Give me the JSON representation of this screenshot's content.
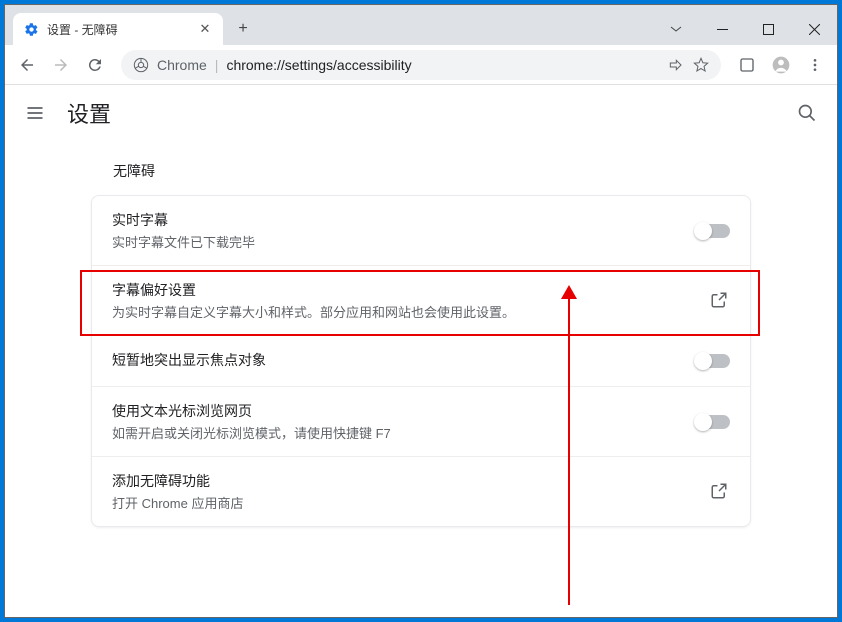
{
  "tab": {
    "title": "设置 - 无障碍"
  },
  "address": {
    "origin": "Chrome",
    "path": "chrome://settings/accessibility"
  },
  "header": {
    "title": "设置"
  },
  "section": {
    "title": "无障碍"
  },
  "rows": {
    "live_caption": {
      "title": "实时字幕",
      "sub": "实时字幕文件已下载完毕"
    },
    "caption_pref": {
      "title": "字幕偏好设置",
      "sub": "为实时字幕自定义字幕大小和样式。部分应用和网站也会使用此设置。"
    },
    "focus_highlight": {
      "title": "短暂地突出显示焦点对象"
    },
    "caret_browse": {
      "title": "使用文本光标浏览网页",
      "sub": "如需开启或关闭光标浏览模式，请使用快捷键 F7"
    },
    "webstore": {
      "title": "添加无障碍功能",
      "sub": "打开 Chrome 应用商店"
    }
  }
}
